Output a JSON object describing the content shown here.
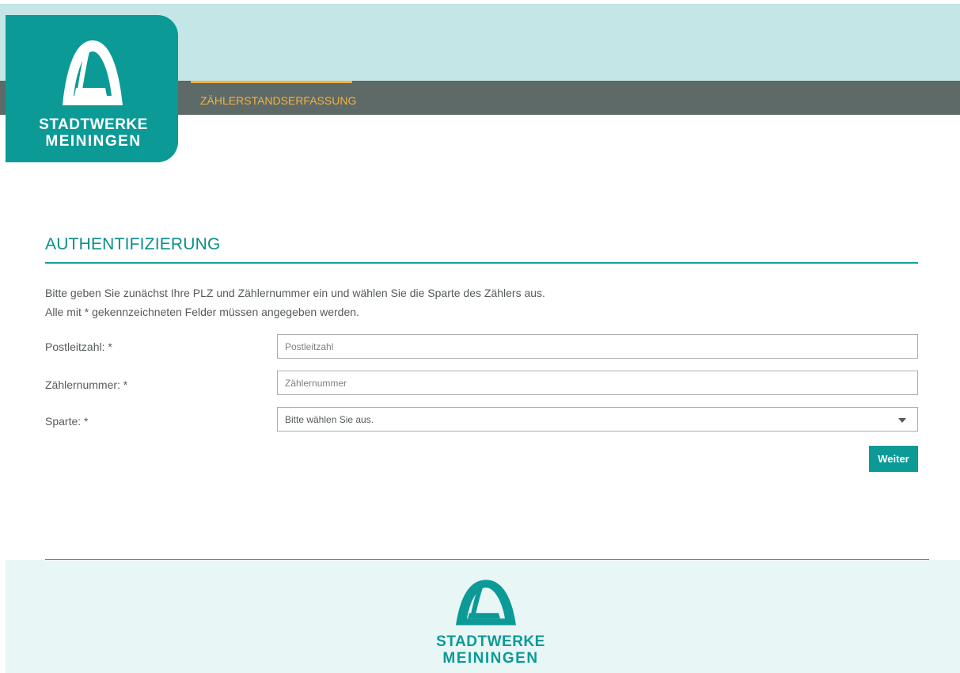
{
  "brand": {
    "line1": "STADTWERKE",
    "line2": "MEININGEN"
  },
  "nav": {
    "tabs": [
      {
        "label": "ZÄHLERSTANDSERFASSUNG",
        "active": true
      }
    ]
  },
  "main": {
    "title": "AUTHENTIFIZIERUNG",
    "intro_line1": "Bitte geben Sie zunächst Ihre PLZ und Zählernummer ein und wählen Sie die Sparte des Zählers aus.",
    "intro_line2": "Alle mit * gekennzeichneten Felder müssen angegeben werden.",
    "fields": {
      "plz": {
        "label": "Postleitzahl: *",
        "placeholder": "Postleitzahl",
        "value": ""
      },
      "zaehlernummer": {
        "label": "Zählernummer: *",
        "placeholder": "Zählernummer",
        "value": ""
      },
      "sparte": {
        "label": "Sparte: *",
        "selected": "Bitte wählen Sie aus."
      }
    },
    "submit_label": "Weiter"
  },
  "colors": {
    "brand_teal": "#0b9a96",
    "header_light": "#c4e6e7",
    "nav_dark": "#5d6a68",
    "nav_accent": "#f6b13e",
    "footer_bg": "#e9f6f6"
  },
  "icons": {
    "logo_mark": "mountain-arch-icon",
    "select_caret": "caret-down-icon"
  }
}
